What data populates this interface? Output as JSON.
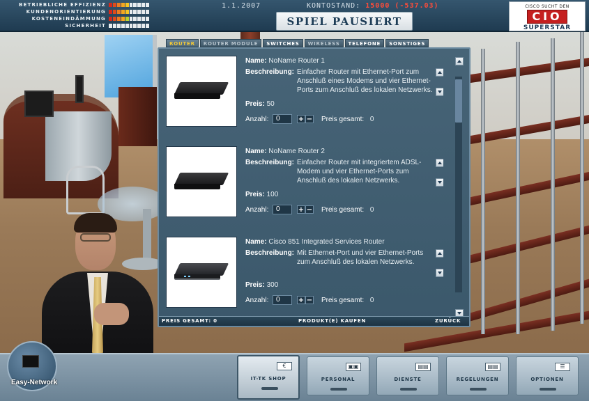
{
  "hud": {
    "stats": [
      {
        "label": "BETRIEBLICHE EFFIZIENZ",
        "colors": [
          "#d32a1c",
          "#e04b1b",
          "#ee7b1f",
          "#f4a620",
          "#f6c523",
          "#e8ecef",
          "#e8ecef",
          "#e8ecef",
          "#e8ecef",
          "#e8ecef"
        ]
      },
      {
        "label": "KUNDENORIENTIERUNG",
        "colors": [
          "#d32a1c",
          "#e04b1b",
          "#ee7b1f",
          "#f4a620",
          "#f6c523",
          "#e8ecef",
          "#e8ecef",
          "#e8ecef",
          "#e8ecef",
          "#e8ecef"
        ]
      },
      {
        "label": "KOSTENEINDÄMMUNG",
        "colors": [
          "#d32a1c",
          "#e04b1b",
          "#ee7b1f",
          "#f4a620",
          "#b8d032",
          "#e8ecef",
          "#e8ecef",
          "#e8ecef",
          "#e8ecef",
          "#e8ecef"
        ]
      },
      {
        "label": "SICHERHEIT",
        "colors": [
          "#e8ecef",
          "#e8ecef",
          "#e8ecef",
          "#e8ecef",
          "#e8ecef",
          "#e8ecef",
          "#e8ecef",
          "#e8ecef",
          "#e8ecef",
          "#e8ecef"
        ]
      }
    ],
    "date": "1.1.2007",
    "konto_label": "KONTOSTAND:",
    "konto_value": "15000 (-537.03)",
    "pause_text": "SPIEL PAUSIERT",
    "logo": {
      "top": "CISCO SUCHT DEN",
      "big": "CIO",
      "bottom": "SUPERSTAR"
    }
  },
  "shop": {
    "tabs": [
      {
        "label": "ROUTER",
        "state": "active"
      },
      {
        "label": "ROUTER MODULE",
        "state": "dim"
      },
      {
        "label": "SWITCHES",
        "state": "normal"
      },
      {
        "label": "WIRELESS",
        "state": "dim"
      },
      {
        "label": "TELEFONE",
        "state": "normal"
      },
      {
        "label": "SONSTIGES",
        "state": "normal"
      }
    ],
    "labels": {
      "name": "Name:",
      "beschreibung": "Beschreibung:",
      "preis": "Preis:",
      "anzahl": "Anzahl:",
      "preis_gesamt": "Preis gesamt:"
    },
    "items": [
      {
        "name": "NoName Router 1",
        "beschreibung": "Einfacher Router mit Ethernet-Port zum Anschluß eines Modems und vier Ethernet-Ports zum Anschluß des lokalen Netzwerks.",
        "preis": "50",
        "anzahl": "0",
        "preis_gesamt": "0"
      },
      {
        "name": "NoName Router 2",
        "beschreibung": "Einfacher Router mit integriertem ADSL-Modem und vier Ethernet-Ports zum Anschluß des lokalen Netzwerks.",
        "preis": "100",
        "anzahl": "0",
        "preis_gesamt": "0"
      },
      {
        "name": "Cisco 851 Integrated Services Router",
        "beschreibung": "Mit Ethernet-Port und vier Ethernet-Ports zum Anschluß des lokalen Netzwerks.",
        "preis": "300",
        "anzahl": "0",
        "preis_gesamt": "0"
      }
    ],
    "plus_minus": [
      "+",
      "−"
    ],
    "footer": {
      "total_label": "PREIS GESAMT: 0",
      "buy_label": "PRODUKT(E) KAUFEN",
      "back_label": "ZURÜCK"
    }
  },
  "bottom": {
    "easy_network_label": "Easy-Network",
    "nav": [
      {
        "label": "IT-TK SHOP",
        "icon": "€",
        "active": true
      },
      {
        "label": "PERSONAL",
        "icon": "▣▣",
        "active": false
      },
      {
        "label": "DIENSTE",
        "icon": "▤▤",
        "active": false
      },
      {
        "label": "REGELUNGEN",
        "icon": "▤▤",
        "active": false
      },
      {
        "label": "OPTIONEN",
        "icon": "☰",
        "active": false
      }
    ]
  }
}
